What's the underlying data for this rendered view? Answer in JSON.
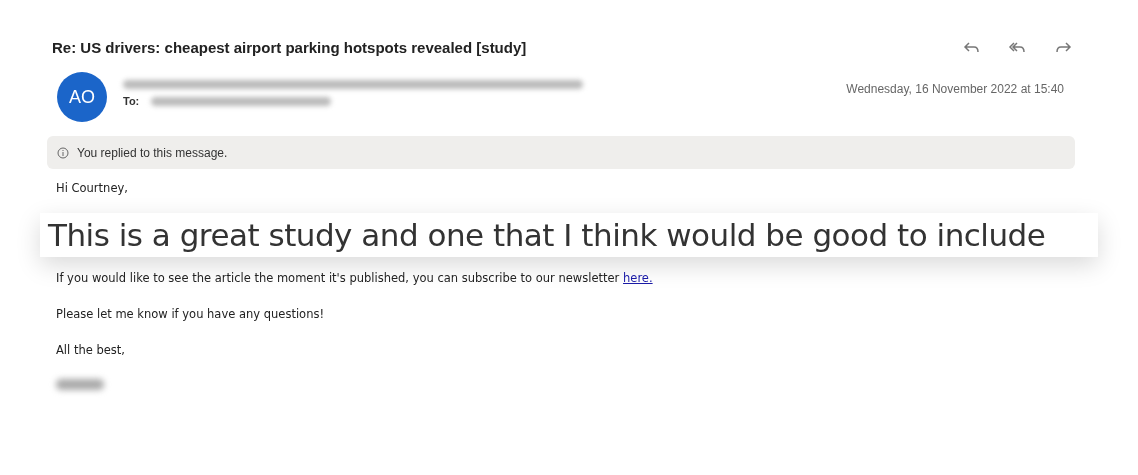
{
  "subject": "Re: US drivers: cheapest airport parking hotspots revealed [study]",
  "sender": {
    "avatar_initials": "AO",
    "to_label": "To:"
  },
  "date": "Wednesday, 16 November 2022 at 15:40",
  "notice": "You replied to this message.",
  "body": [
    {
      "kind": "text",
      "text": "Hi Courtney,"
    },
    {
      "kind": "callout",
      "text": "This is a great study and one that I think would be good to include"
    },
    {
      "kind": "text",
      "text": "If you would like to see the article the moment it's published, you can subscribe to our newsletter ",
      "link": "here."
    },
    {
      "kind": "text",
      "text": "Please let me know if you have any questions!"
    },
    {
      "kind": "text",
      "text": "All the best,"
    },
    {
      "kind": "redacted"
    }
  ]
}
